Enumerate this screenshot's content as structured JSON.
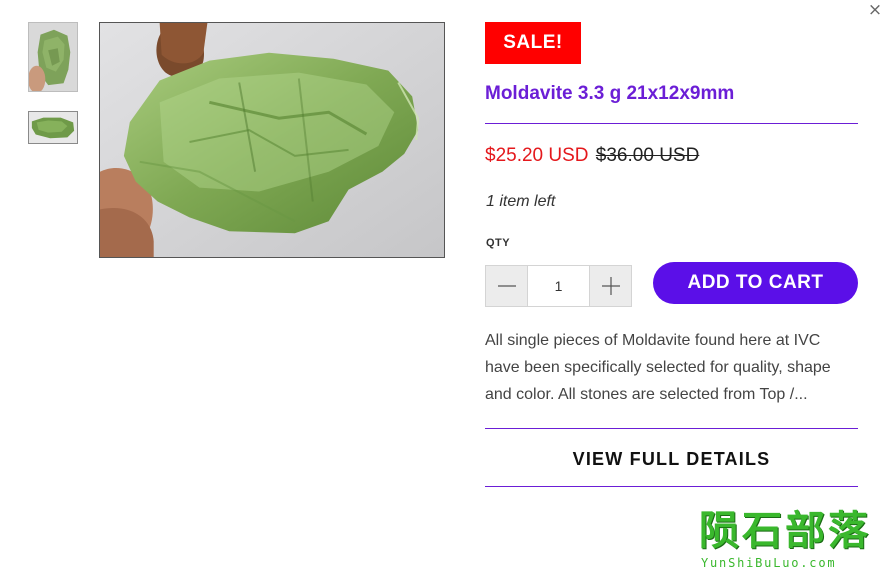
{
  "close": {
    "glyph": "×"
  },
  "gallery": {
    "thumbnails": [
      {
        "icon": "moldavite-thumbnail-portrait"
      },
      {
        "icon": "moldavite-thumbnail-landscape"
      }
    ],
    "main_image": {
      "icon": "moldavite-gemstone-photo"
    }
  },
  "product": {
    "badge": "SALE!",
    "title": "Moldavite 3.3 g 21x12x9mm",
    "sale_price": "$25.20 USD",
    "compare_price": "$36.00 USD",
    "stock_note": "1 item left",
    "qty_label": "QTY",
    "qty_value": "1",
    "add_to_cart_label": "ADD TO CART",
    "description": "All single pieces of Moldavite found here at IVC have been specifically selected for quality, shape and color. All stones are selected from Top /...",
    "view_details_label": "VIEW FULL DETAILS"
  },
  "watermark": {
    "text_cn": "陨石部落",
    "url": "YunShiBuLuo.com"
  },
  "colors": {
    "accent_purple": "#6b1ed6",
    "button_purple": "#5b0fe8",
    "sale_red": "#ff0000",
    "price_red": "#e4181c",
    "watermark_green": "#3ab82d"
  }
}
